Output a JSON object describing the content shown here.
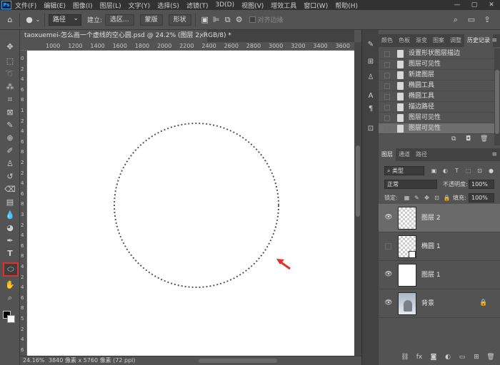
{
  "menu": {
    "logo": "Ps",
    "items": [
      "文件(F)",
      "编辑(E)",
      "图像(I)",
      "图层(L)",
      "文字(Y)",
      "选择(S)",
      "滤镜(T)",
      "3D(D)",
      "视图(V)",
      "增效工具",
      "窗口(W)",
      "帮助(H)"
    ],
    "window_controls": [
      "—",
      "▢",
      "✕"
    ]
  },
  "options": {
    "home_icon": "home-icon",
    "mode_value": "路径",
    "build_label": "建立:",
    "selection_button": "选区...",
    "mask_button": "蒙版",
    "shape_button": "形状",
    "align_edges_label": "对齐边缘"
  },
  "document": {
    "tab_title": "taoxuemei-怎么画一个虚线的空心圆.psd @ 24.2% (图层 2, RGB/8) *",
    "close": "×"
  },
  "ruler": {
    "top": [
      "1000",
      "1200",
      "1400",
      "1600",
      "1800",
      "2000",
      "2200",
      "2400",
      "2600",
      "2800",
      "3000",
      "3200",
      "3400",
      "3600"
    ],
    "left": [
      "0",
      "2",
      "4",
      "6",
      "8",
      "1",
      "2",
      "4",
      "6",
      "8",
      "2",
      "2",
      "4",
      "6",
      "8",
      "3",
      "2",
      "4",
      "6",
      "8",
      "4",
      "2",
      "4",
      "6",
      "8",
      "5",
      "2",
      "4",
      "6"
    ]
  },
  "status": {
    "zoom": "24.16%",
    "info": "3840 像素 x 5760 像素 (72 ppi)"
  },
  "panel_top_tabs": [
    "颜色",
    "色板",
    "渐变",
    "图案",
    "调整",
    "历史记录"
  ],
  "history": {
    "items": [
      "设置形状图层描边",
      "图层可见性",
      "新建图层",
      "椭圆工具",
      "椭圆工具",
      "描边路径",
      "图层可见性",
      "图层可见性"
    ],
    "selected_index": 7
  },
  "layers_tabs": [
    "图层",
    "通道",
    "路径"
  ],
  "layers": {
    "filter_label": "类型",
    "blend_mode": "正常",
    "opacity_label": "不透明度:",
    "opacity_value": "100%",
    "lock_label": "锁定:",
    "fill_label": "填充:",
    "fill_value": "100%",
    "items": [
      {
        "name": "图层 2",
        "visible": true,
        "selected": true
      },
      {
        "name": "椭圆 1",
        "visible": false,
        "selected": false
      },
      {
        "name": "图层 1",
        "visible": true,
        "selected": false
      },
      {
        "name": "背景",
        "visible": true,
        "selected": false
      }
    ]
  },
  "colors": {
    "highlight": "#e0322b",
    "arrow": "#e0322b",
    "circle_stroke": "#555555"
  }
}
